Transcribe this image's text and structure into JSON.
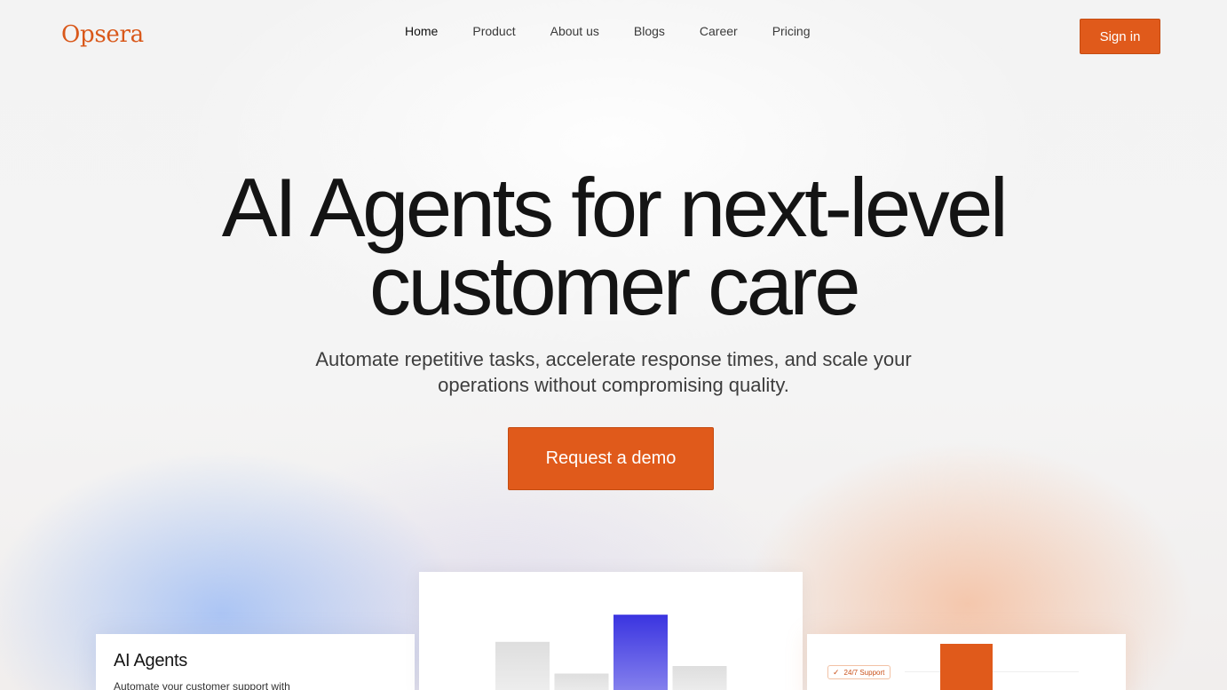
{
  "brand": {
    "name": "Opsera",
    "accent": "#e05a1b"
  },
  "nav": {
    "items": [
      {
        "label": "Home",
        "active": true
      },
      {
        "label": "Product",
        "active": false
      },
      {
        "label": "About us",
        "active": false
      },
      {
        "label": "Blogs",
        "active": false
      },
      {
        "label": "Career",
        "active": false
      },
      {
        "label": "Pricing",
        "active": false
      }
    ],
    "signin_label": "Sign in"
  },
  "hero": {
    "title_line1": "AI Agents for next-level",
    "title_line2": "customer care",
    "subtitle_line1": "Automate repetitive tasks, accelerate response times, and scale your",
    "subtitle_line2": "operations without compromising quality.",
    "cta_label": "Request a demo"
  },
  "cards": {
    "left": {
      "title": "AI Agents",
      "description": "Automate your customer support with"
    },
    "right": {
      "badge": "24/7 Support",
      "badge_icon": "check-icon"
    }
  },
  "chart_data": {
    "type": "bar",
    "categories": [
      "",
      "",
      "",
      ""
    ],
    "values": [
      72,
      30,
      108,
      40
    ],
    "highlight_index": 2,
    "colors": {
      "default": "#e2e2e2",
      "highlight_top": "#3a34e0",
      "highlight_bottom": "#8a86ee"
    }
  }
}
